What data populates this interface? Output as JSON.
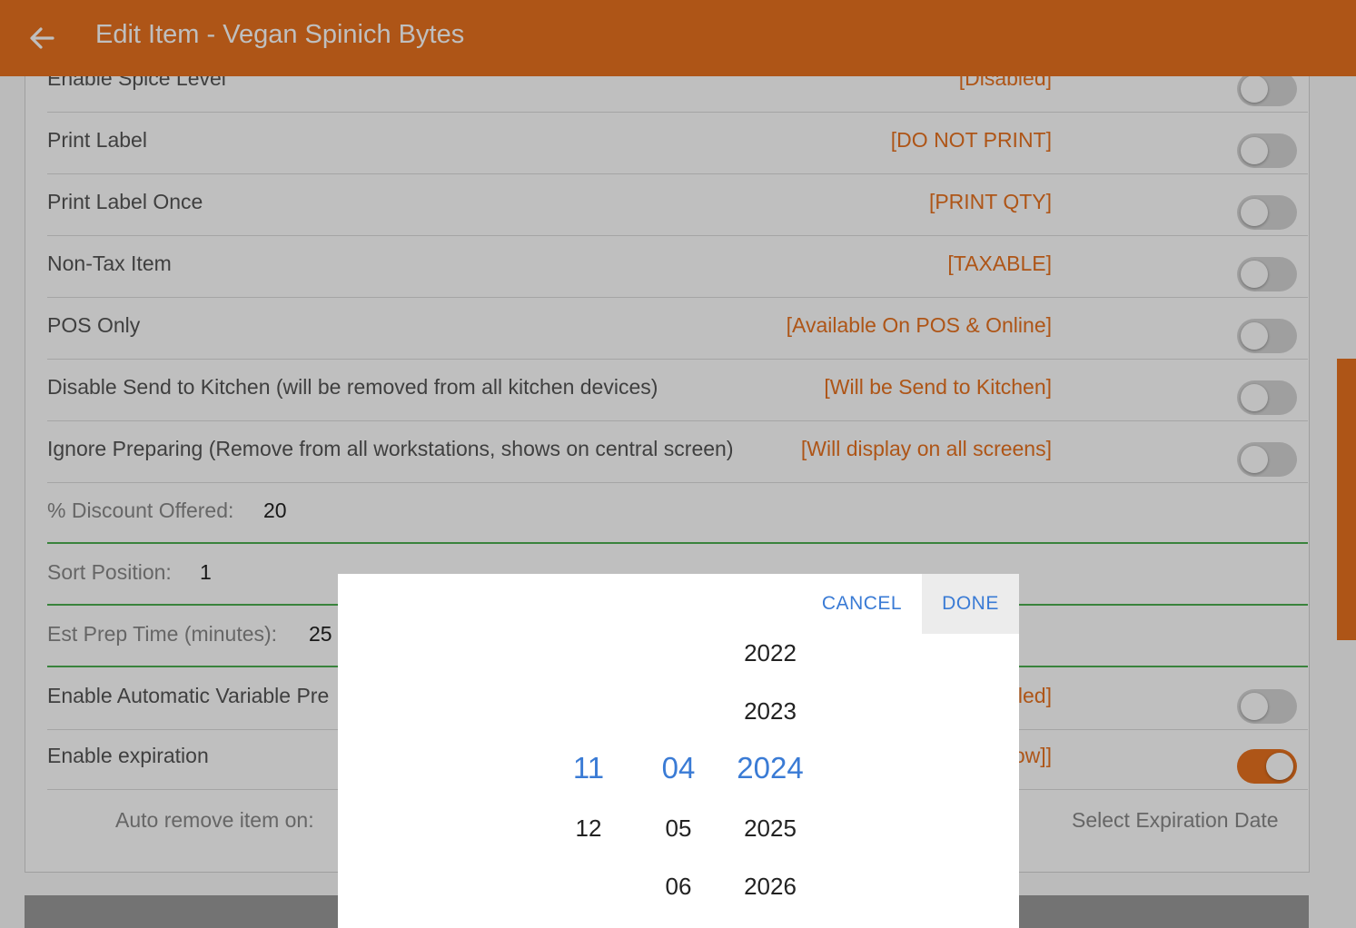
{
  "header": {
    "title": "Edit Item - Vegan Spinich Bytes",
    "back_icon": "arrow-left-icon"
  },
  "settings": [
    {
      "label": "Enable Spice Level",
      "status": "[Disabled]",
      "on": false
    },
    {
      "label": "Print Label",
      "status": "[DO NOT PRINT]",
      "on": false
    },
    {
      "label": "Print Label Once",
      "status": "[PRINT QTY]",
      "on": false
    },
    {
      "label": "Non-Tax Item",
      "status": "[TAXABLE]",
      "on": false
    },
    {
      "label": "POS Only",
      "status": "[Available On POS & Online]",
      "on": false
    },
    {
      "label": "Disable Send to Kitchen (will be removed from all kitchen devices)",
      "status": "[Will be Send to Kitchen]",
      "on": false
    },
    {
      "label": "Ignore Preparing (Remove from all workstations, shows on central screen)",
      "status": "[Will display on all screens]",
      "on": false
    }
  ],
  "fields": {
    "discount": {
      "label": "% Discount Offered:",
      "value": "20"
    },
    "sort": {
      "label": "Sort Position:",
      "value": "1"
    },
    "prep": {
      "label": "Est Prep Time (minutes):",
      "value": "25"
    }
  },
  "auto_variable": {
    "label": "Enable Automatic Variable Pre",
    "status": "led]",
    "on": false
  },
  "expiration": {
    "label": "Enable expiration",
    "status": "ow]]",
    "on": true
  },
  "auto_remove": {
    "label": "Auto remove item on:",
    "select_placeholder": "Select Expiration Date"
  },
  "picker": {
    "cancel_label": "CANCEL",
    "done_label": "DONE",
    "day": {
      "selected": "11",
      "below": [
        "12"
      ]
    },
    "month": {
      "selected": "04",
      "below": [
        "05",
        "06"
      ]
    },
    "year": {
      "above": [
        "2022",
        "2023"
      ],
      "selected": "2024",
      "below": [
        "2025",
        "2026"
      ]
    }
  },
  "colors": {
    "accent": "#e8721f",
    "link": "#3a7bd5",
    "field_underline": "#4caf50"
  }
}
